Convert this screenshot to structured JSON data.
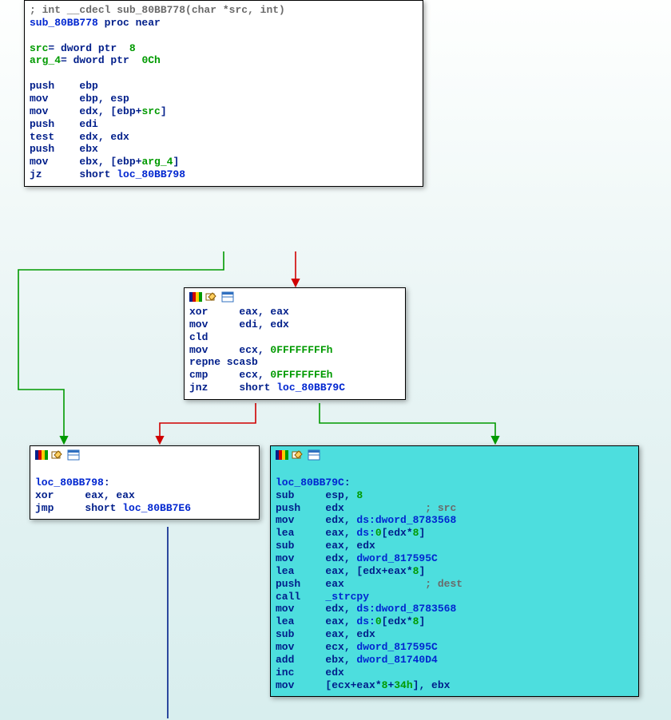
{
  "blocks": {
    "b0": {
      "lines": [
        [
          [
            "kw-gray",
            "; int __cdecl sub_80BB778(char *src, int)"
          ]
        ],
        [
          [
            "kw-blue",
            "sub_80BB778 "
          ],
          [
            "kw-navy",
            "proc near"
          ]
        ],
        [
          [
            "",
            " "
          ]
        ],
        [
          [
            "kw-green",
            "src"
          ],
          [
            "kw-navy",
            "= dword ptr  "
          ],
          [
            "kw-green",
            "8"
          ]
        ],
        [
          [
            "kw-green",
            "arg_4"
          ],
          [
            "kw-navy",
            "= dword ptr  "
          ],
          [
            "kw-green",
            "0Ch"
          ]
        ],
        [
          [
            "",
            " "
          ]
        ],
        [
          [
            "kw-navy",
            "push    ebp"
          ]
        ],
        [
          [
            "kw-navy",
            "mov     ebp, esp"
          ]
        ],
        [
          [
            "kw-navy",
            "mov     edx, [ebp+"
          ],
          [
            "kw-green",
            "src"
          ],
          [
            "kw-navy",
            "]"
          ]
        ],
        [
          [
            "kw-navy",
            "push    edi"
          ]
        ],
        [
          [
            "kw-navy",
            "test    edx, edx"
          ]
        ],
        [
          [
            "kw-navy",
            "push    ebx"
          ]
        ],
        [
          [
            "kw-navy",
            "mov     ebx, [ebp+"
          ],
          [
            "kw-green",
            "arg_4"
          ],
          [
            "kw-navy",
            "]"
          ]
        ],
        [
          [
            "kw-navy",
            "jz      short "
          ],
          [
            "kw-blue",
            "loc_80BB798"
          ]
        ]
      ]
    },
    "b1": {
      "lines": [
        [
          [
            "kw-navy",
            "xor     eax, eax"
          ]
        ],
        [
          [
            "kw-navy",
            "mov     edi, edx"
          ]
        ],
        [
          [
            "kw-navy",
            "cld"
          ]
        ],
        [
          [
            "kw-navy",
            "mov     ecx, "
          ],
          [
            "kw-green",
            "0FFFFFFFFh"
          ]
        ],
        [
          [
            "kw-navy",
            "repne scasb"
          ]
        ],
        [
          [
            "kw-navy",
            "cmp     ecx, "
          ],
          [
            "kw-green",
            "0FFFFFFFEh"
          ]
        ],
        [
          [
            "kw-navy",
            "jnz     short "
          ],
          [
            "kw-blue",
            "loc_80BB79C"
          ]
        ]
      ]
    },
    "b2": {
      "lines": [
        [
          [
            "",
            " "
          ]
        ],
        [
          [
            "kw-blue",
            "loc_80BB798"
          ],
          [
            "kw-navy",
            ":"
          ]
        ],
        [
          [
            "kw-navy",
            "xor     eax, eax"
          ]
        ],
        [
          [
            "kw-navy",
            "jmp     short "
          ],
          [
            "kw-blue",
            "loc_80BB7E6"
          ]
        ]
      ]
    },
    "b3": {
      "lines": [
        [
          [
            "",
            " "
          ]
        ],
        [
          [
            "kw-blue",
            "loc_80BB79C"
          ],
          [
            "kw-navy",
            ":"
          ]
        ],
        [
          [
            "kw-navy",
            "sub     esp, "
          ],
          [
            "kw-green",
            "8"
          ]
        ],
        [
          [
            "kw-navy",
            "push    edx             "
          ],
          [
            "kw-gray",
            "; src"
          ]
        ],
        [
          [
            "kw-navy",
            "mov     edx, "
          ],
          [
            "kw-blue",
            "ds:dword_8783568"
          ]
        ],
        [
          [
            "kw-navy",
            "lea     eax, "
          ],
          [
            "kw-blue",
            "ds:"
          ],
          [
            "kw-green",
            "0"
          ],
          [
            "kw-navy",
            "[edx*"
          ],
          [
            "kw-green",
            "8"
          ],
          [
            "kw-navy",
            "]"
          ]
        ],
        [
          [
            "kw-navy",
            "sub     eax, edx"
          ]
        ],
        [
          [
            "kw-navy",
            "mov     edx, "
          ],
          [
            "kw-blue",
            "dword_817595C"
          ]
        ],
        [
          [
            "kw-navy",
            "lea     eax, [edx+eax*"
          ],
          [
            "kw-green",
            "8"
          ],
          [
            "kw-navy",
            "]"
          ]
        ],
        [
          [
            "kw-navy",
            "push    eax             "
          ],
          [
            "kw-gray",
            "; dest"
          ]
        ],
        [
          [
            "kw-navy",
            "call    "
          ],
          [
            "kw-blue",
            "_strcpy"
          ]
        ],
        [
          [
            "kw-navy",
            "mov     edx, "
          ],
          [
            "kw-blue",
            "ds:dword_8783568"
          ]
        ],
        [
          [
            "kw-navy",
            "lea     eax, "
          ],
          [
            "kw-blue",
            "ds:"
          ],
          [
            "kw-green",
            "0"
          ],
          [
            "kw-navy",
            "[edx*"
          ],
          [
            "kw-green",
            "8"
          ],
          [
            "kw-navy",
            "]"
          ]
        ],
        [
          [
            "kw-navy",
            "sub     eax, edx"
          ]
        ],
        [
          [
            "kw-navy",
            "mov     ecx, "
          ],
          [
            "kw-blue",
            "dword_817595C"
          ]
        ],
        [
          [
            "kw-navy",
            "add     ebx, "
          ],
          [
            "kw-blue",
            "dword_81740D4"
          ]
        ],
        [
          [
            "kw-navy",
            "inc     edx"
          ]
        ],
        [
          [
            "kw-navy",
            "mov     [ecx+eax*"
          ],
          [
            "kw-green",
            "8"
          ],
          [
            "kw-navy",
            "+"
          ],
          [
            "kw-green",
            "34h"
          ],
          [
            "kw-navy",
            "], ebx"
          ]
        ]
      ]
    }
  }
}
